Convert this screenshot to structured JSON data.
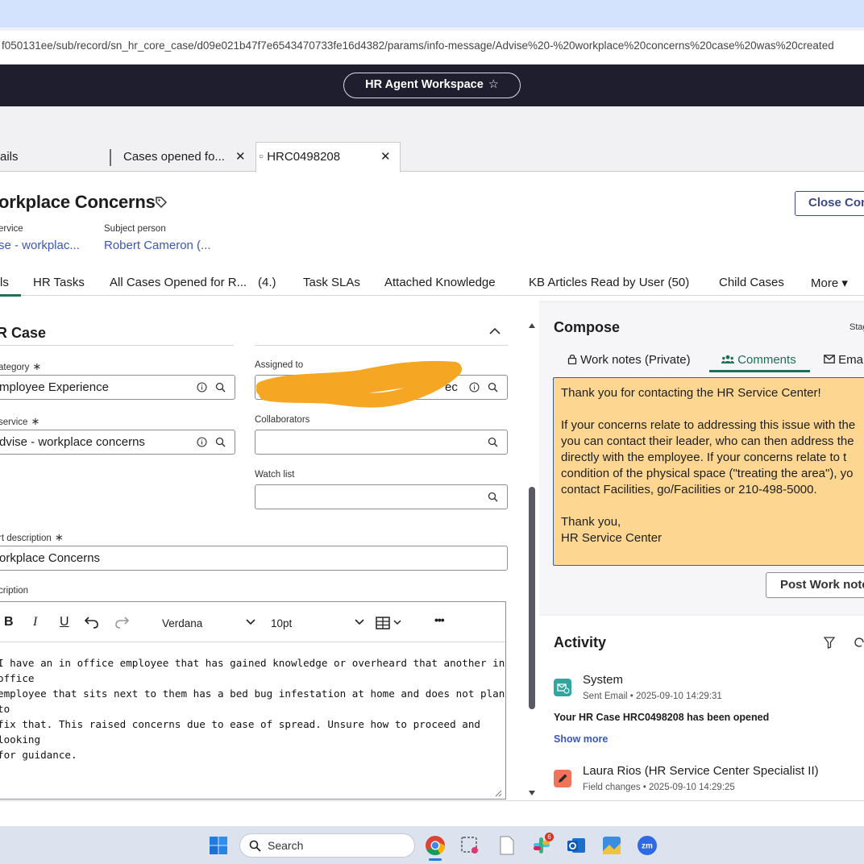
{
  "browser": {
    "url": "f050131ee/sub/record/sn_hr_core_case/d09e021b47f7e6543470733fe16d4382/params/info-message/Advise%20-%20workplace%20concerns%20case%20was%20created"
  },
  "header": {
    "workspace_title": "HR Agent Workspace",
    "star_icon": "star-icon"
  },
  "context_tabs": [
    {
      "label": "ails"
    },
    {
      "label": "Cases opened fo..."
    },
    {
      "label": "HRC0498208"
    }
  ],
  "record": {
    "title": "orkplace Concerns",
    "close_button": "Close Con",
    "service_label": "ervice",
    "service_value": "se - workplac...",
    "subject_label": "Subject person",
    "subject_value": "Robert Cameron (..."
  },
  "form_tabs": [
    {
      "label": "ls"
    },
    {
      "label": "HR Tasks"
    },
    {
      "label": "All Cases Opened for R..."
    },
    {
      "label": "(4.)"
    },
    {
      "label": "Task SLAs"
    },
    {
      "label": "Attached Knowledge"
    },
    {
      "label": "KB Articles Read by User (50)"
    },
    {
      "label": "Child Cases"
    },
    {
      "label": "More ▾"
    }
  ],
  "section": {
    "title": "R Case"
  },
  "fields": {
    "category_label": "ategory",
    "category_value": "mployee Experience",
    "assigned_label": "Assigned to",
    "assigned_value": "ec",
    "service_label": "service",
    "service_value": "dvise - workplace concerns",
    "collaborators_label": "Collaborators",
    "watchlist_label": "Watch list",
    "short_desc_label": "rt description",
    "short_desc_value": "orkplace Concerns",
    "description_label": "cription",
    "required_mark": "∗"
  },
  "editor": {
    "bold": "B",
    "italic": "I",
    "underline": "U",
    "font": "Verdana",
    "size": "10pt",
    "more": "•••",
    "body_lines": [
      "I have an in office employee that has gained knowledge or overheard that another in office",
      "employee that sits next to them has a bed bug infestation at home and does not plan to",
      "fix that. This raised concerns due to ease of spread. Unsure how to proceed and looking",
      "for guidance."
    ]
  },
  "compose": {
    "title": "Compose",
    "stage_label": "Stag",
    "tab_work_notes": "Work notes (Private)",
    "tab_comments": "Comments",
    "tab_email": "Emai",
    "message": "Thank you for contacting the HR Service Center!\n\nIf your concerns relate to addressing this issue with the\nyou can contact their leader, who can then address the\ndirectly with the employee. If your concerns relate to t\ncondition of the physical space (\"treating the area\"), yo\ncontact Facilities, go/Facilities or 210-498-5000.\n\nThank you,\nHR Service Center",
    "post_button": "Post Work note"
  },
  "activity": {
    "title": "Activity",
    "items": [
      {
        "name": "System",
        "meta": "Sent Email • 2025-09-10 14:29:31",
        "message": "Your HR Case HRC0498208 has been opened",
        "avatar_color": "#2fa7a0"
      },
      {
        "name": "Laura Rios (HR Service Center Specialist II)",
        "meta": "Field changes • 2025-09-10 14:29:25",
        "avatar_color": "#f0735a"
      }
    ],
    "show_more": "Show more"
  },
  "taskbar": {
    "search_placeholder": "Search",
    "slack_badge": "6",
    "zoom_label": "zm"
  },
  "colors": {
    "header_bg": "#1f1e2e",
    "accent_green": "#1e6f55",
    "link_blue": "#3b57b8",
    "compose_bg": "#fdd792",
    "redaction": "#f5a623"
  }
}
